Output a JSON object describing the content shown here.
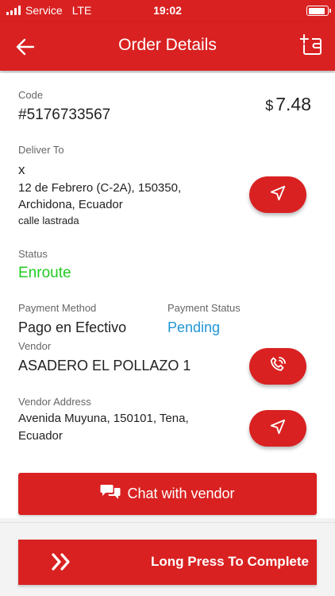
{
  "status_bar": {
    "carrier": "Service",
    "network": "LTE",
    "time": "19:02",
    "battery_level": 0.9
  },
  "app_bar": {
    "title": "Order Details"
  },
  "order": {
    "code_label": "Code",
    "code": "#5176733567",
    "currency": "$",
    "amount": "7.48",
    "deliver_label": "Deliver To",
    "recipient": "x",
    "address_line1": "12 de Febrero (C-2A), 150350,",
    "address_line2": "Archidona, Ecuador",
    "address_note": "calle lastrada",
    "status_label": "Status",
    "status": "Enroute",
    "payment_method_label": "Payment Method",
    "payment_method": "Pago en Efectivo",
    "payment_status_label": "Payment Status",
    "payment_status": "Pending",
    "vendor_label": "Vendor",
    "vendor": "ASADERO EL POLLAZO 1",
    "vendor_address_label": "Vendor Address",
    "vendor_address_line1": "Avenida Muyuna, 150101, Tena,",
    "vendor_address_line2": "Ecuador"
  },
  "actions": {
    "chat": "Chat with vendor",
    "complete": "Long Press To Complete"
  },
  "icons": {
    "back": "arrow-left-icon",
    "add_wallet": "add-wallet-icon",
    "navigate": "navigation-arrow-icon",
    "call": "phone-call-icon",
    "chat": "chat-bubbles-icon",
    "double_chevron": "double-chevron-right-icon"
  },
  "colors": {
    "primary": "#d92121",
    "status_green": "#22cc22",
    "pending_blue": "#2196d6"
  }
}
